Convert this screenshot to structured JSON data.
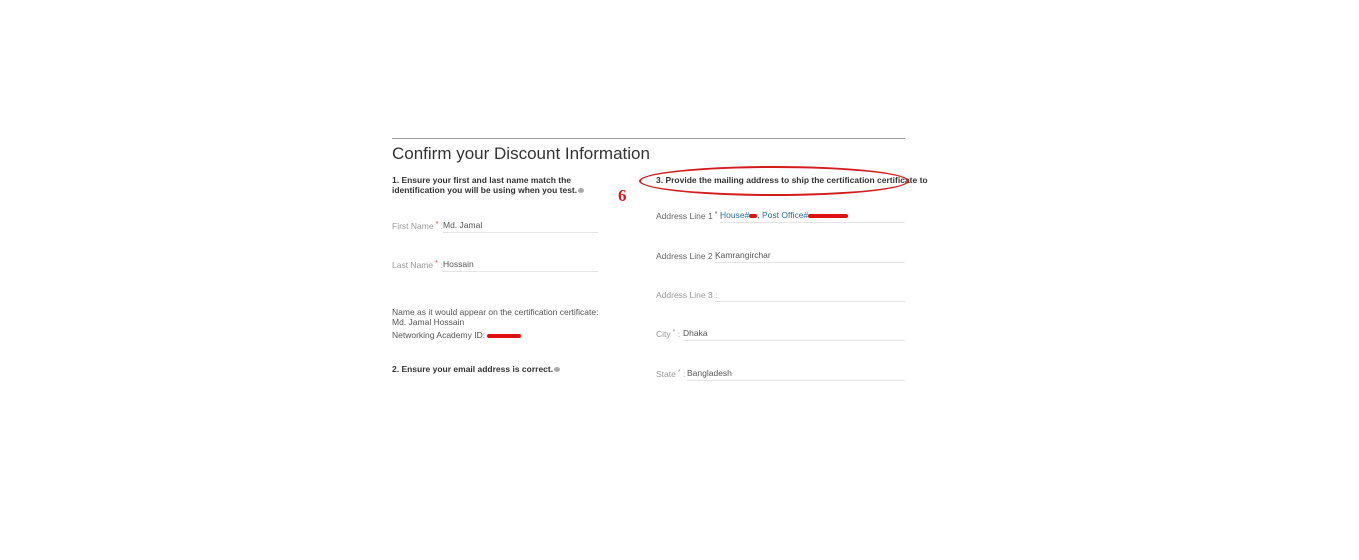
{
  "title": "Confirm your Discount Information",
  "step1": "1. Ensure your first and last name match the identification you will be using when you test.",
  "step2": "2. Ensure your email address is correct.",
  "step3": "3. Provide the mailing address to ship the certification certificate to",
  "annotation_number": "6",
  "annotation_color": "#d21d1d",
  "name_fields": [
    {
      "label": "First Name",
      "sep": ":",
      "value": "Md. Jamal"
    },
    {
      "label": "Last Name",
      "sep": ":",
      "value": "Hossain"
    }
  ],
  "certificate_name": "Name as it would appear on the certification certificate: Md. Jamal Hossain",
  "academy_id_label": "Networking Academy ID:",
  "address_fields": [
    {
      "label": "Address Line 1",
      "sep": ":",
      "value_a": "House#",
      "value_b": ", Post Office#"
    },
    {
      "label": "Address Line 2 :",
      "value": "Kamrangirchar"
    },
    {
      "label": "Address Line 3 :",
      "value": ""
    },
    {
      "label": "City",
      "sep": ":",
      "value": "Dhaka"
    },
    {
      "label": "State",
      "sep": ":",
      "value": "Bangladesh"
    }
  ]
}
